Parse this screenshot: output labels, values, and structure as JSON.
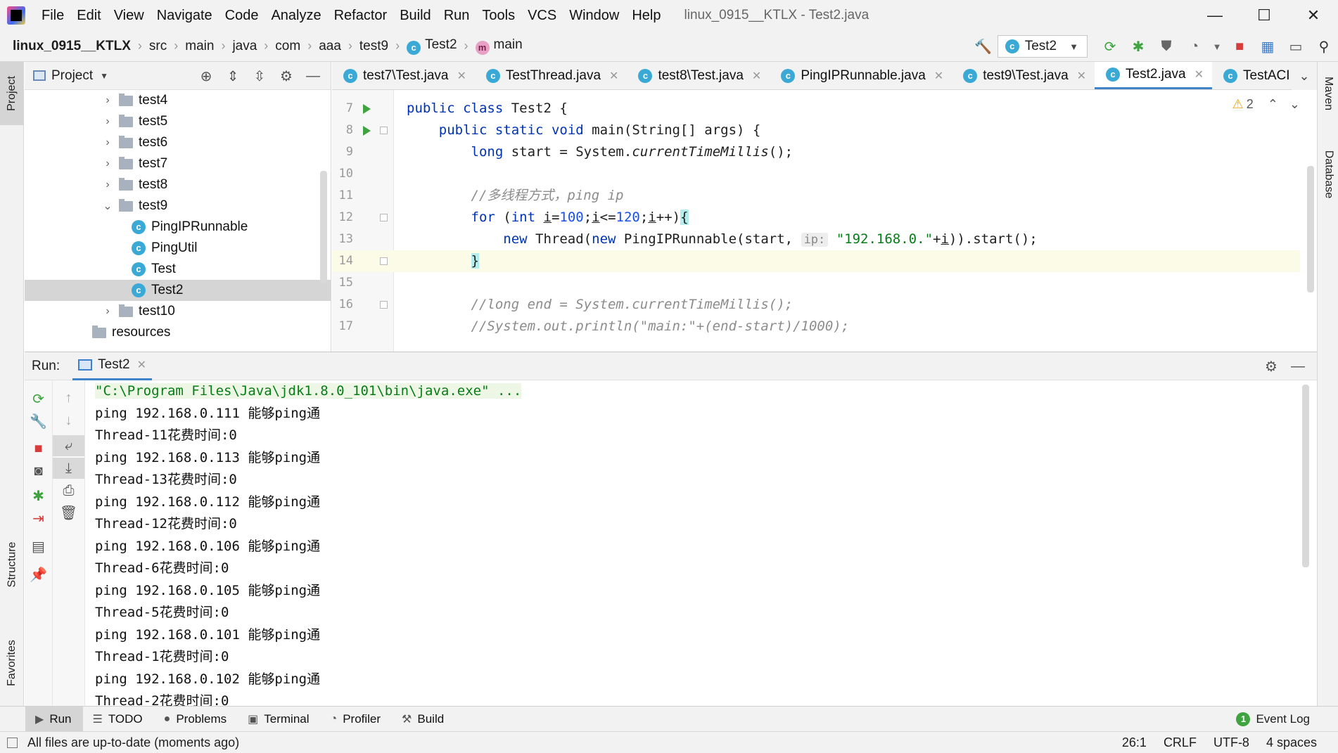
{
  "window": {
    "title": "linux_0915__KTLX - Test2.java",
    "menu": [
      "File",
      "Edit",
      "View",
      "Navigate",
      "Code",
      "Analyze",
      "Refactor",
      "Build",
      "Run",
      "Tools",
      "VCS",
      "Window",
      "Help"
    ],
    "minimize_glyph": "—",
    "maximize_glyph": "☐",
    "close_glyph": "✕"
  },
  "breadcrumb": {
    "project": "linux_0915__KTLX",
    "parts": [
      "src",
      "main",
      "java",
      "com",
      "aaa",
      "test9"
    ],
    "class_name": "Test2",
    "method_name": "main",
    "separator": "›"
  },
  "run_config": {
    "name": "Test2",
    "dropdown_glyph": "▼"
  },
  "toolwindows": {
    "left": [
      "Project",
      "Structure",
      "Favorites"
    ],
    "right": [
      "Maven",
      "Database"
    ]
  },
  "project_panel": {
    "title": "Project",
    "tree": [
      {
        "label": "test4",
        "type": "folder",
        "expanded": false,
        "indent": 1
      },
      {
        "label": "test5",
        "type": "folder",
        "expanded": false,
        "indent": 1
      },
      {
        "label": "test6",
        "type": "folder",
        "expanded": false,
        "indent": 1
      },
      {
        "label": "test7",
        "type": "folder",
        "expanded": false,
        "indent": 1
      },
      {
        "label": "test8",
        "type": "folder",
        "expanded": false,
        "indent": 1
      },
      {
        "label": "test9",
        "type": "folder",
        "expanded": true,
        "indent": 1
      },
      {
        "label": "PingIPRunnable",
        "type": "class",
        "indent": 2
      },
      {
        "label": "PingUtil",
        "type": "class",
        "indent": 2
      },
      {
        "label": "Test",
        "type": "class",
        "indent": 2
      },
      {
        "label": "Test2",
        "type": "class",
        "indent": 2,
        "selected": true
      },
      {
        "label": "test10",
        "type": "folder",
        "expanded": false,
        "indent": 1
      },
      {
        "label": "resources",
        "type": "folder",
        "indent": 0
      }
    ]
  },
  "editor": {
    "tabs": [
      {
        "label": "test7\\Test.java",
        "active": false
      },
      {
        "label": "TestThread.java",
        "active": false
      },
      {
        "label": "test8\\Test.java",
        "active": false
      },
      {
        "label": "PingIPRunnable.java",
        "active": false
      },
      {
        "label": "test9\\Test.java",
        "active": false
      },
      {
        "label": "Test2.java",
        "active": true
      },
      {
        "label": "TestACI",
        "active": false
      }
    ],
    "warning_count": "2",
    "lines": [
      {
        "num": "7",
        "run": true,
        "fold": false
      },
      {
        "num": "8",
        "run": true,
        "fold": true
      },
      {
        "num": "9"
      },
      {
        "num": "10"
      },
      {
        "num": "11"
      },
      {
        "num": "12",
        "fold": true
      },
      {
        "num": "13"
      },
      {
        "num": "14",
        "fold": true,
        "current": true
      },
      {
        "num": "15"
      },
      {
        "num": "16",
        "fold": true
      },
      {
        "num": "17"
      }
    ],
    "code": {
      "l7_kw1": "public",
      "l7_kw2": "class",
      "l7_rest": " Test2 {",
      "l8_kw1": "public",
      "l8_kw2": "static",
      "l8_kw3": "void",
      "l8_rest": " main(String[] args) {",
      "l9_kw": "long",
      "l9_a": " start = System.",
      "l9_m": "currentTimeMillis",
      "l9_b": "();",
      "l11_cmt": "//多线程方式，ping ip",
      "l12_kw": "for",
      "l12_a": " (",
      "l12_kw2": "int",
      "l12_sp": " ",
      "l12_i1": "i",
      "l12_eq": "=",
      "l12_n1": "100",
      "l12_semi1": ";",
      "l12_i2": "i",
      "l12_le": "<=",
      "l12_n2": "120",
      "l12_semi2": ";",
      "l12_i3": "i",
      "l12_pp": "++)",
      "l12_brace": "{",
      "l13_kw": "new",
      "l13_a": " Thread(",
      "l13_kw2": "new",
      "l13_b": " PingIPRunnable(start, ",
      "l13_hint": "ip:",
      "l13_str": "\"192.168.0.\"",
      "l13_c": "+",
      "l13_i": "i",
      "l13_d": ")).start();",
      "l14_brace": "}",
      "l16_cmt": "//long end = System.currentTimeMillis();",
      "l17_cmt": "//System.out.println(\"main:\"+(end-start)/1000);"
    }
  },
  "run_panel": {
    "label": "Run:",
    "tab": "Test2",
    "console": [
      "\"C:\\Program Files\\Java\\jdk1.8.0_101\\bin\\java.exe\" ...",
      "ping 192.168.0.111 能够ping通",
      "Thread-11花费时间:0",
      "ping 192.168.0.113 能够ping通",
      "Thread-13花费时间:0",
      "ping 192.168.0.112 能够ping通",
      "Thread-12花费时间:0",
      "ping 192.168.0.106 能够ping通",
      "Thread-6花费时间:0",
      "ping 192.168.0.105 能够ping通",
      "Thread-5花费时间:0",
      "ping 192.168.0.101 能够ping通",
      "Thread-1花费时间:0",
      "ping 192.168.0.102 能够ping通",
      "Thread-2花费时间:0"
    ]
  },
  "bottom_bar": {
    "tabs": [
      "Run",
      "TODO",
      "Problems",
      "Terminal",
      "Profiler",
      "Build"
    ],
    "event_log": "Event Log",
    "event_count": "1"
  },
  "status_bar": {
    "message": "All files are up-to-date (moments ago)",
    "position": "26:1",
    "line_sep": "CRLF",
    "encoding": "UTF-8",
    "indent": "4 spaces"
  },
  "colors": {
    "accent": "#4083c9",
    "keyword": "#0033b3",
    "string": "#067d17",
    "number": "#1750eb",
    "comment": "#8c8c8c"
  }
}
